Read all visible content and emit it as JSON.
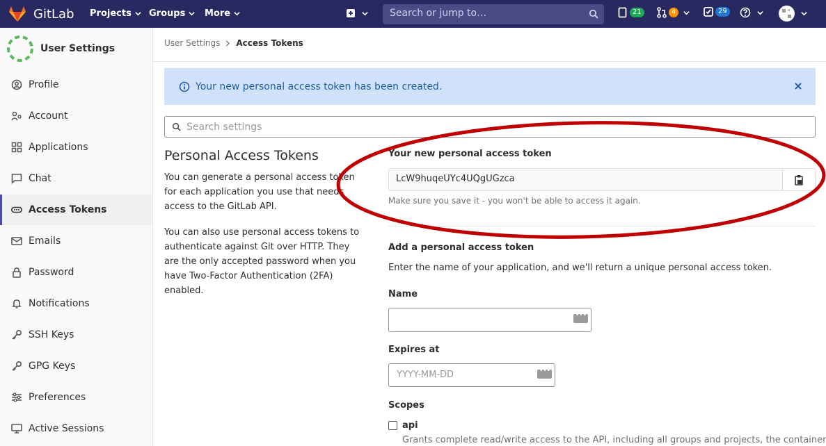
{
  "navbar": {
    "brand": "GitLab",
    "menus": [
      "Projects",
      "Groups",
      "More"
    ],
    "search_placeholder": "Search or jump to…",
    "counts": {
      "issues": "21",
      "merge_requests": "4",
      "todos": "29"
    },
    "colors": {
      "navbar": "#292961",
      "green": "#1aaa55",
      "orange": "#fc9403",
      "blue": "#1f78d1"
    }
  },
  "sidebar": {
    "title": "User Settings",
    "items": [
      {
        "label": "Profile",
        "icon": "profile-icon"
      },
      {
        "label": "Account",
        "icon": "account-icon"
      },
      {
        "label": "Applications",
        "icon": "applications-icon"
      },
      {
        "label": "Chat",
        "icon": "chat-icon"
      },
      {
        "label": "Access Tokens",
        "icon": "token-icon",
        "active": true
      },
      {
        "label": "Emails",
        "icon": "mail-icon"
      },
      {
        "label": "Password",
        "icon": "lock-icon"
      },
      {
        "label": "Notifications",
        "icon": "bell-icon"
      },
      {
        "label": "SSH Keys",
        "icon": "key-icon"
      },
      {
        "label": "GPG Keys",
        "icon": "key-icon"
      },
      {
        "label": "Preferences",
        "icon": "sliders-icon"
      },
      {
        "label": "Active Sessions",
        "icon": "monitor-icon"
      }
    ]
  },
  "breadcrumb": {
    "parent": "User Settings",
    "current": "Access Tokens"
  },
  "flash": {
    "message": "Your new personal access token has been created."
  },
  "settings_search": {
    "placeholder": "Search settings"
  },
  "intro": {
    "title": "Personal Access Tokens",
    "p1": "You can generate a personal access token for each application you use that needs access to the GitLab API.",
    "p2": "You can also use personal access tokens to authenticate against Git over HTTP. They are the only accepted password when you have Two-Factor Authentication (2FA) enabled."
  },
  "new_token": {
    "label": "Your new personal access token",
    "value": "LcW9huqeUYc4UQgUGzca",
    "help": "Make sure you save it - you won't be able to access it again."
  },
  "add_form": {
    "heading": "Add a personal access token",
    "description": "Enter the name of your application, and we'll return a unique personal access token.",
    "name_label": "Name",
    "name_value": "",
    "expires_label": "Expires at",
    "expires_placeholder": "YYYY-MM-DD",
    "scopes_label": "Scopes",
    "scopes": [
      {
        "name": "api",
        "checked": false,
        "description": "Grants complete read/write access to the API, including all groups and projects, the container"
      }
    ]
  },
  "annotation": {
    "color": "#c00000"
  }
}
